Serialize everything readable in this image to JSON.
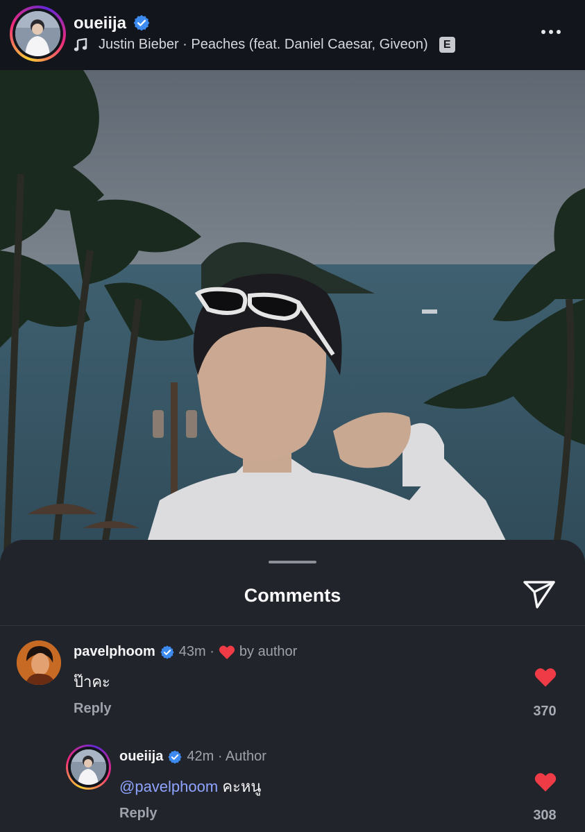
{
  "header": {
    "username": "oueiija",
    "music": "Justin Bieber · Peaches (feat. Daniel Caesar, Giveon)",
    "explicit_badge": "E"
  },
  "sheet": {
    "title": "Comments"
  },
  "comments": [
    {
      "username": "pavelphoom",
      "time": "43m ·",
      "liked_by": "by author",
      "text": "ป๊าคะ",
      "reply_label": "Reply",
      "likes": "370"
    },
    {
      "username": "oueiija",
      "time": "42m · Author",
      "mention": "@pavelphoom",
      "text": "คะหนู",
      "reply_label": "Reply",
      "likes": "308"
    }
  ],
  "colors": {
    "heart": "#ee3b45",
    "verified": "#3d8bf0",
    "mention": "#8ea4ff",
    "sheet_bg": "#22242b"
  },
  "icons": [
    "music-note-icon",
    "verified-icon",
    "more-icon",
    "send-icon",
    "heart-icon"
  ]
}
